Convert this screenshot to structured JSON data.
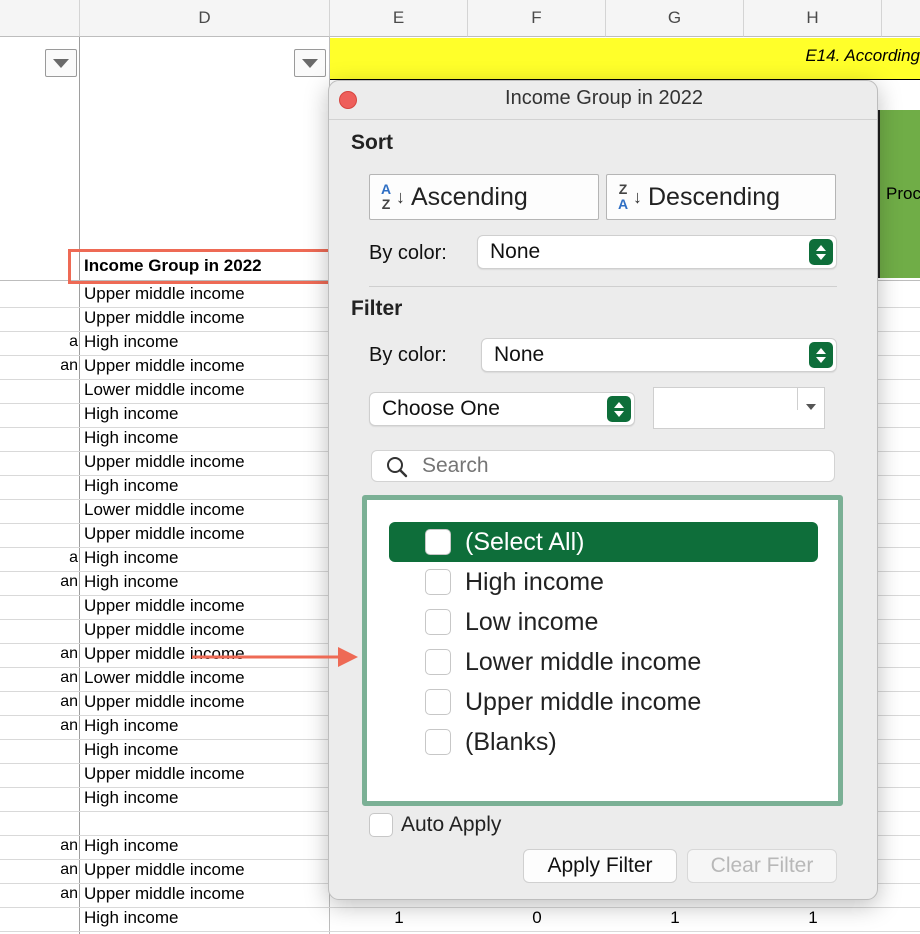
{
  "columns": {
    "d": "D",
    "e": "E",
    "f": "F",
    "g": "G",
    "h": "H"
  },
  "header_cell": {
    "title": "Income Group in 2022",
    "banner": "E14. According",
    "side": "Proc"
  },
  "rows": [
    {
      "a": "",
      "d": "Upper middle income"
    },
    {
      "a": "",
      "d": "Upper middle income"
    },
    {
      "a": "a",
      "d": "High income"
    },
    {
      "a": "an",
      "d": "Upper middle income"
    },
    {
      "a": "",
      "d": "Lower middle income"
    },
    {
      "a": "",
      "d": "High income"
    },
    {
      "a": "",
      "d": "High income"
    },
    {
      "a": "",
      "d": "Upper middle income"
    },
    {
      "a": "",
      "d": "High income"
    },
    {
      "a": "",
      "d": "Lower middle income"
    },
    {
      "a": "",
      "d": "Upper middle income"
    },
    {
      "a": "a",
      "d": "High income"
    },
    {
      "a": "an",
      "d": "High income"
    },
    {
      "a": "",
      "d": "Upper middle income"
    },
    {
      "a": "",
      "d": "Upper middle income"
    },
    {
      "a": "an",
      "d": "Upper middle income"
    },
    {
      "a": "an",
      "d": "Lower middle income"
    },
    {
      "a": "an",
      "d": "Upper middle income"
    },
    {
      "a": "an",
      "d": "High income"
    },
    {
      "a": "",
      "d": "High income"
    },
    {
      "a": "",
      "d": "Upper middle income"
    },
    {
      "a": "",
      "d": "High income"
    },
    {
      "a": "",
      "d": ""
    },
    {
      "a": "an",
      "d": "High income"
    },
    {
      "a": "an",
      "d": "Upper middle income"
    },
    {
      "a": "an",
      "d": "Upper middle income"
    },
    {
      "a": "",
      "d": "High income"
    }
  ],
  "last_row_numbers": {
    "e": "1",
    "f": "0",
    "g": "1",
    "h": "1"
  },
  "popup": {
    "title": "Income Group in 2022",
    "sort": {
      "title": "Sort",
      "ascending": "Ascending",
      "descending": "Descending",
      "asc_glyph_top": "A",
      "asc_glyph_bottom": "Z",
      "desc_glyph_top": "Z",
      "desc_glyph_bottom": "A",
      "by_color_label": "By color:",
      "by_color_value": "None"
    },
    "filter": {
      "title": "Filter",
      "by_color_label": "By color:",
      "by_color_value": "None",
      "condition_value": "Choose One",
      "condition_text": "",
      "search_placeholder": "Search",
      "items": [
        "(Select All)",
        "High income",
        "Low income",
        "Lower middle income",
        "Upper middle income",
        "(Blanks)"
      ],
      "auto_apply": "Auto Apply",
      "apply_button": "Apply Filter",
      "clear_button": "Clear Filter"
    }
  },
  "colors": {
    "accent": "#0e6e3a",
    "highlight_box": "#ee6a55",
    "list_border": "#7bb095",
    "banner_yellow": "#ffff2a",
    "green_column": "#70ad47"
  }
}
